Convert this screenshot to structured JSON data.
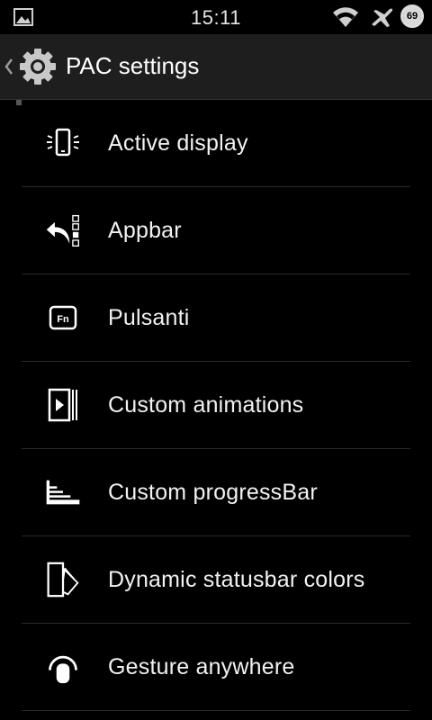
{
  "statusbar": {
    "time": "15:11",
    "battery_level": "69",
    "icons": [
      "gallery-notification-icon",
      "wifi-icon",
      "airplane-icon",
      "battery-icon"
    ]
  },
  "actionbar": {
    "title": "PAC settings",
    "icon": "gear-icon"
  },
  "items": [
    {
      "label": "Active display",
      "icon": "active-display-icon"
    },
    {
      "label": "Appbar",
      "icon": "appbar-icon"
    },
    {
      "label": "Pulsanti",
      "icon": "fn-key-icon"
    },
    {
      "label": "Custom animations",
      "icon": "animation-icon"
    },
    {
      "label": "Custom progressBar",
      "icon": "progressbar-icon"
    },
    {
      "label": "Dynamic statusbar colors",
      "icon": "color-swatch-icon"
    },
    {
      "label": "Gesture anywhere",
      "icon": "gesture-icon"
    }
  ],
  "colors": {
    "background": "#000000",
    "actionbar": "#1e1e1e",
    "text": "#f2f2f2",
    "divider": "#2a2a2a"
  }
}
